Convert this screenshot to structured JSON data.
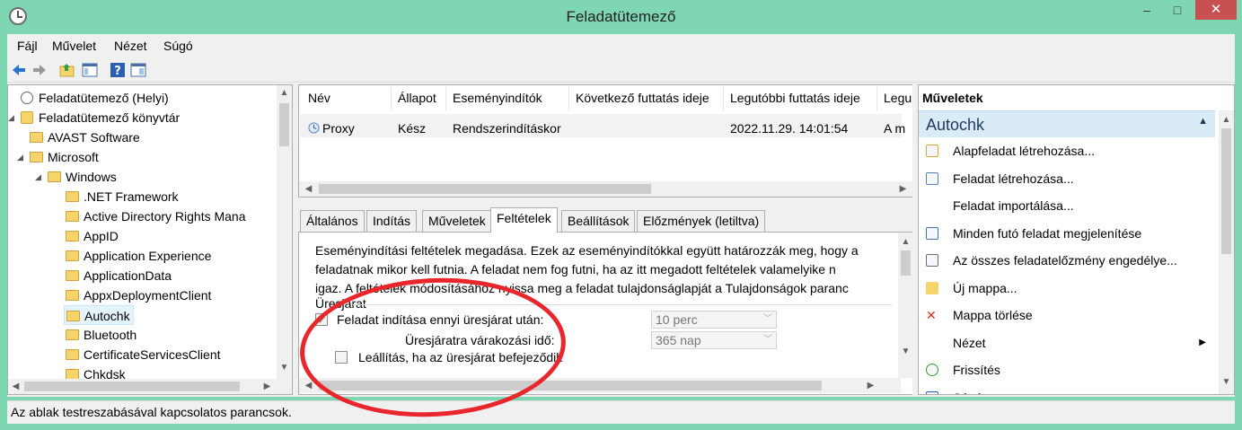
{
  "window": {
    "title": "Feladatütemező",
    "minimize": "–",
    "maximize": "□",
    "close": "✕"
  },
  "menu": [
    "Fájl",
    "Művelet",
    "Nézet",
    "Súgó"
  ],
  "tree": {
    "items": [
      {
        "label": "Feladatütemező (Helyi)",
        "level": 0,
        "icon": "clock-icon",
        "expander": ""
      },
      {
        "label": "Feladatütemező könyvtár",
        "level": 0,
        "icon": "folder-clock-icon",
        "expander": "◢"
      },
      {
        "label": "AVAST Software",
        "level": 1,
        "icon": "folder-icon",
        "expander": ""
      },
      {
        "label": "Microsoft",
        "level": 1,
        "icon": "folder-icon",
        "expander": "◢"
      },
      {
        "label": "Windows",
        "level": 2,
        "icon": "folder-icon",
        "expander": "◢"
      },
      {
        "label": ".NET Framework",
        "level": 3,
        "icon": "folder-icon",
        "expander": ""
      },
      {
        "label": "Active Directory Rights Mana",
        "level": 3,
        "icon": "folder-icon",
        "expander": ""
      },
      {
        "label": "AppID",
        "level": 3,
        "icon": "folder-icon",
        "expander": ""
      },
      {
        "label": "Application Experience",
        "level": 3,
        "icon": "folder-icon",
        "expander": ""
      },
      {
        "label": "ApplicationData",
        "level": 3,
        "icon": "folder-icon",
        "expander": ""
      },
      {
        "label": "AppxDeploymentClient",
        "level": 3,
        "icon": "folder-icon",
        "expander": ""
      },
      {
        "label": "Autochk",
        "level": 3,
        "icon": "folder-icon",
        "expander": "",
        "selected": true
      },
      {
        "label": "Bluetooth",
        "level": 3,
        "icon": "folder-icon",
        "expander": ""
      },
      {
        "label": "CertificateServicesClient",
        "level": 3,
        "icon": "folder-icon",
        "expander": ""
      },
      {
        "label": "Chkdsk",
        "level": 3,
        "icon": "folder-icon",
        "expander": ""
      }
    ]
  },
  "tasklist": {
    "columns": [
      "Név",
      "Állapot",
      "Eseményindítók",
      "Következő futtatás ideje",
      "Legutóbbi futtatás ideje",
      "Legu"
    ],
    "rows": [
      {
        "name": "Proxy",
        "status": "Kész",
        "triggers": "Rendszerindításkor",
        "next": "",
        "last": "2022.11.29. 14:01:54",
        "result": "A m"
      }
    ]
  },
  "tabs": [
    "Általános",
    "Indítás",
    "Műveletek",
    "Feltételek",
    "Beállítások",
    "Előzmények (letiltva)"
  ],
  "active_tab": "Feltételek",
  "conditions": {
    "desc_lines": [
      "Eseményindítási feltételek megadása. Ezek az eseményindítókkal együtt határozzák meg, hogy a",
      "feladatnak mikor kell futnia. A feladat nem fog futni, ha az itt megadott feltételek valamelyike n",
      "igaz. A feltételek módosításához nyissa meg a feladat tulajdonságlapját a Tulajdonságok paranc"
    ],
    "group_label": "Üresjárat",
    "idle_start_label": "Feladat indítása ennyi üresjárat után:",
    "idle_start_checked": true,
    "idle_start_value": "10 perc",
    "idle_wait_label": "Üresjáratra várakozási idő:",
    "idle_wait_value": "365 nap",
    "stop_label": "Leállítás, ha az üresjárat befejeződik"
  },
  "actions": {
    "header": "Műveletek",
    "section": "Autochk",
    "items": [
      {
        "label": "Alapfeladat létrehozása...",
        "icon": "basic-task-icon"
      },
      {
        "label": "Feladat létrehozása...",
        "icon": "create-task-icon"
      },
      {
        "label": "Feladat importálása...",
        "icon": ""
      },
      {
        "label": "Minden futó feladat megjelenítése",
        "icon": "running-tasks-icon"
      },
      {
        "label": "Az összes feladatelőzmény engedélye...",
        "icon": "history-icon"
      },
      {
        "label": "Új mappa...",
        "icon": "new-folder-icon"
      },
      {
        "label": "Mappa törlése",
        "icon": "delete-icon"
      },
      {
        "label": "Nézet",
        "icon": "",
        "submenu": true
      },
      {
        "label": "Frissítés",
        "icon": "refresh-icon"
      },
      {
        "label": "Súgó",
        "icon": "help-icon"
      }
    ]
  },
  "status": "Az ablak testreszabásával kapcsolatos parancsok.",
  "colors": {
    "accent": "#7fd6b2",
    "close": "#c75050",
    "highlight": "#e8262b"
  }
}
